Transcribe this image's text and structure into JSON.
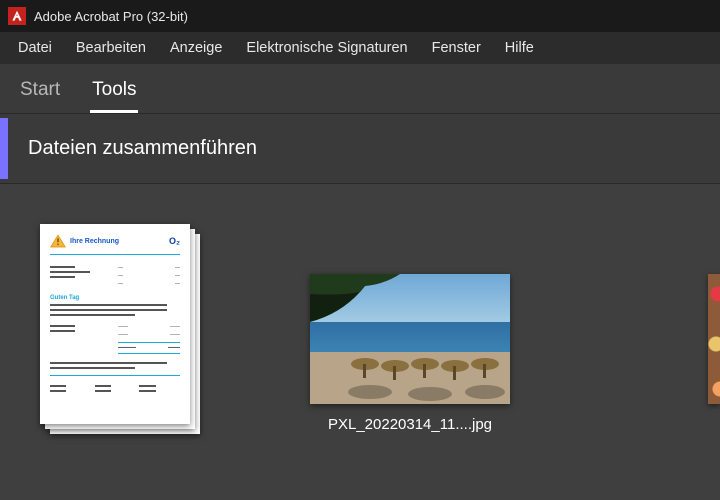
{
  "titlebar": {
    "title": "Adobe Acrobat Pro (32-bit)"
  },
  "menu": {
    "items": [
      "Datei",
      "Bearbeiten",
      "Anzeige",
      "Elektronische Signaturen",
      "Fenster",
      "Hilfe"
    ]
  },
  "tabs": {
    "items": [
      {
        "label": "Start",
        "active": false
      },
      {
        "label": "Tools",
        "active": true
      }
    ]
  },
  "tool": {
    "title": "Dateien zusammenführen"
  },
  "files": [
    {
      "label": "",
      "type": "pdf-stack"
    },
    {
      "label": "PXL_20220314_11....jpg",
      "type": "photo"
    }
  ],
  "doc_preview": {
    "title": "Ihre Rechnung",
    "brand": "O₂",
    "section": "Guten Tag"
  },
  "colors": {
    "accent": "#7b71ff",
    "app_red": "#c4221f"
  }
}
